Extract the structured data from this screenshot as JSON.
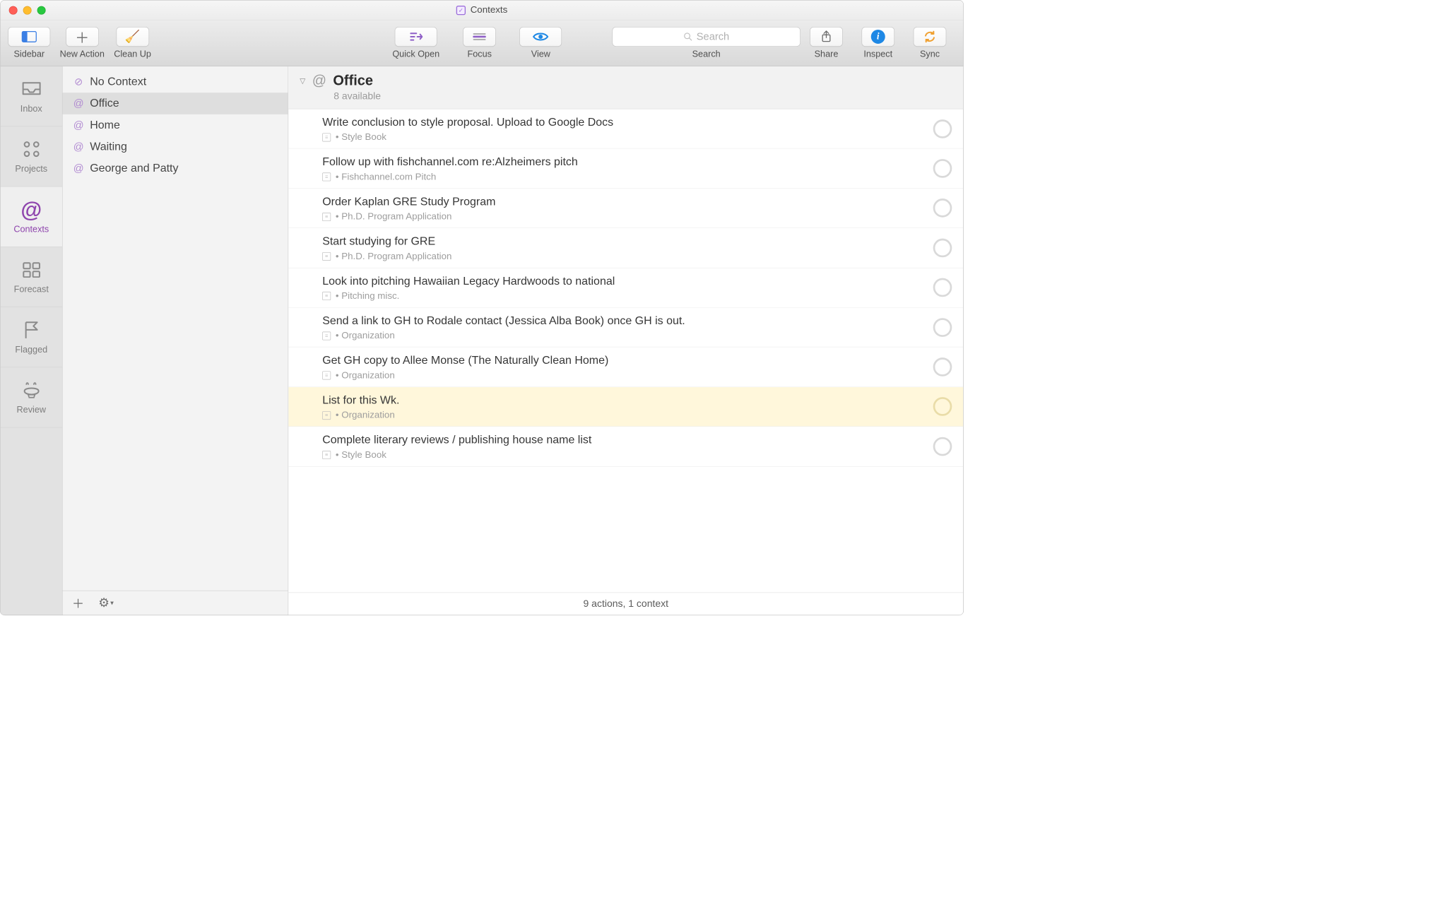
{
  "window": {
    "title": "Contexts"
  },
  "toolbar": {
    "sidebar": "Sidebar",
    "new_action": "New Action",
    "clean_up": "Clean Up",
    "quick_open": "Quick Open",
    "focus": "Focus",
    "view": "View",
    "search_label": "Search",
    "search_placeholder": "Search",
    "share": "Share",
    "inspect": "Inspect",
    "sync": "Sync"
  },
  "rail": {
    "items": [
      {
        "label": "Inbox"
      },
      {
        "label": "Projects"
      },
      {
        "label": "Contexts"
      },
      {
        "label": "Forecast"
      },
      {
        "label": "Flagged"
      },
      {
        "label": "Review"
      }
    ]
  },
  "contexts": {
    "items": [
      {
        "label": "No Context"
      },
      {
        "label": "Office"
      },
      {
        "label": "Home"
      },
      {
        "label": "Waiting"
      },
      {
        "label": "George and Patty"
      }
    ],
    "selected_index": 1
  },
  "content": {
    "header_title": "Office",
    "header_sub": "8 available"
  },
  "tasks": [
    {
      "title": "Write conclusion to style proposal. Upload to Google Docs",
      "project": "Style Book",
      "hl": false
    },
    {
      "title": "Follow up with fishchannel.com re:Alzheimers pitch",
      "project": "Fishchannel.com Pitch",
      "hl": false
    },
    {
      "title": "Order Kaplan GRE Study Program",
      "project": "Ph.D. Program Application",
      "hl": false
    },
    {
      "title": "Start studying for GRE",
      "project": "Ph.D. Program Application",
      "hl": false
    },
    {
      "title": "Look into pitching Hawaiian Legacy Hardwoods to national",
      "project": "Pitching misc.",
      "hl": false
    },
    {
      "title": "Send a link to GH to Rodale contact (Jessica Alba Book) once GH is out.",
      "project": "Organization",
      "hl": false
    },
    {
      "title": "Get GH copy to Allee Monse (The Naturally Clean Home)",
      "project": "Organization",
      "hl": false
    },
    {
      "title": "List for this Wk.",
      "project": "Organization",
      "hl": true
    },
    {
      "title": "Complete literary reviews / publishing house name list",
      "project": "Style Book",
      "hl": false
    }
  ],
  "status": "9 actions, 1 context"
}
